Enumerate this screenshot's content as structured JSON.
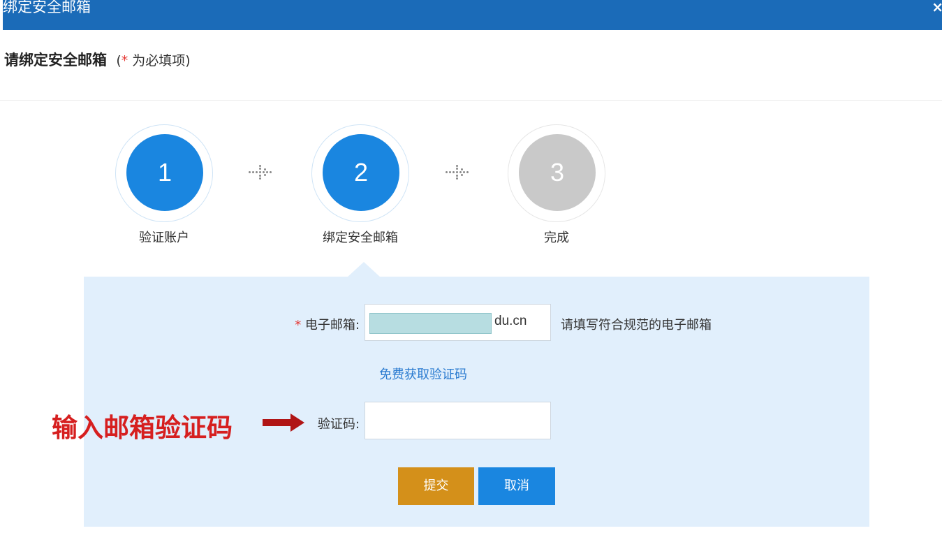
{
  "dialog": {
    "title": "绑定安全邮箱",
    "close_label": "×"
  },
  "heading": {
    "main": "请绑定安全邮箱",
    "note_open": "(",
    "required_star": "*",
    "note_text": " 为必填项)"
  },
  "steps": [
    {
      "number": "1",
      "label": "验证账户",
      "state": "done"
    },
    {
      "number": "2",
      "label": "绑定安全邮箱",
      "state": "current"
    },
    {
      "number": "3",
      "label": "完成",
      "state": "pending"
    }
  ],
  "form": {
    "email": {
      "required_star": "*",
      "label": "电子邮箱:",
      "visible_suffix": "du.cn",
      "hint": "请填写符合规范的电子邮箱"
    },
    "get_code_link": "免费获取验证码",
    "code": {
      "label": "验证码:",
      "value": ""
    },
    "submit_label": "提交",
    "cancel_label": "取消"
  },
  "annotation": {
    "text": "输入邮箱验证码"
  },
  "colors": {
    "titlebar": "#1b6bb8",
    "step_active": "#1a86e0",
    "step_pending": "#c9c9c9",
    "panel": "#e1effc",
    "submit": "#d4901a",
    "cancel": "#1a86e0",
    "annotation": "#d61f1f"
  }
}
